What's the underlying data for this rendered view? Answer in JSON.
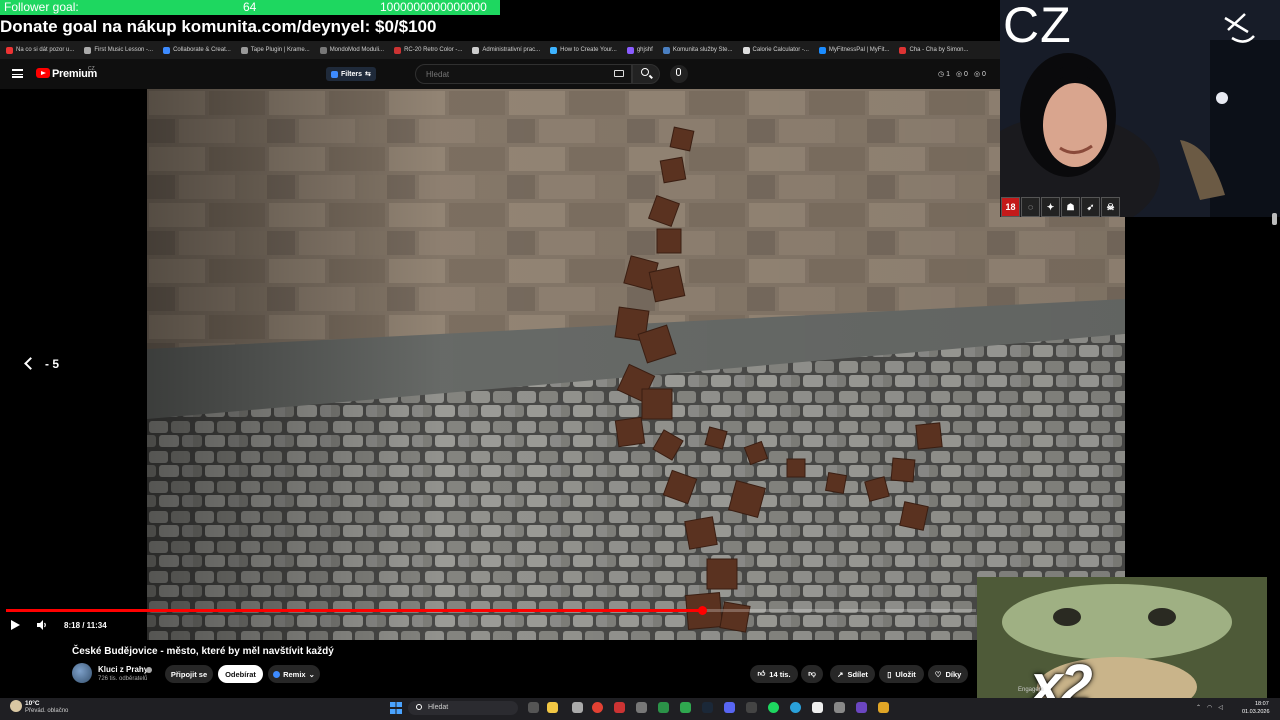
{
  "overlay": {
    "follower_label": "Follower goal:",
    "follower_count": "64",
    "follower_target": "1000000000000000",
    "donate_text": "Donate goal na nákup komunita.com/deynyel: $0/$100",
    "cz_label": "CZ",
    "badge_18": "18",
    "meme_multiplier": "x2",
    "engagement": "Engagem"
  },
  "bookmarks": [
    {
      "label": "Na co si dát pozor u...",
      "color": "#e33"
    },
    {
      "label": "First Music Lesson -...",
      "color": "#aaa"
    },
    {
      "label": "Collaborate & Creat...",
      "color": "#3d8bff"
    },
    {
      "label": "Tape Plugin | Krame...",
      "color": "#999"
    },
    {
      "label": "MondoMod Moduli...",
      "color": "#777"
    },
    {
      "label": "RC-20 Retro Color -...",
      "color": "#c33"
    },
    {
      "label": "Administrativní prac...",
      "color": "#ccc"
    },
    {
      "label": "How to Create Your...",
      "color": "#3db3ff"
    },
    {
      "label": "ghjshf",
      "color": "#8a5cff"
    },
    {
      "label": "Komunita služby Ste...",
      "color": "#4a7fc1"
    },
    {
      "label": "Calorie Calculator -...",
      "color": "#ddd"
    },
    {
      "label": "MyFitnessPal | MyFit...",
      "color": "#1b8cff"
    },
    {
      "label": "Cha - Cha by Simon...",
      "color": "#d33"
    }
  ],
  "youtube": {
    "brand": "Premium",
    "region": "CZ",
    "filters_label": "Filters",
    "search_placeholder": "Hledat",
    "stats": [
      "1",
      "0",
      "0"
    ]
  },
  "player": {
    "skip_label": "- 5",
    "current_time": "8:18",
    "duration": "11:34",
    "time_label": "8:18 / 11:34",
    "progress": 0.7176
  },
  "video": {
    "title": "České Budějovice - město, které by měl navštívit každý",
    "channel": "Kluci z Prahy",
    "subscribers": "726 tis. odběratelů",
    "join_label": "Připojit se",
    "subscribe_label": "Odebírat",
    "remix_label": "Remix",
    "likes": "14 tis.",
    "share_label": "Sdílet",
    "save_label": "Uložit",
    "thanks_label": "Díky"
  },
  "taskbar": {
    "weather_temp": "10°C",
    "weather_desc": "Převád. oblačno",
    "search_label": "Hledat",
    "time": "18:07",
    "date": "01.03.2026"
  },
  "colors": {
    "progress": "#ff0000",
    "follower_bar": "#1ed760",
    "youtube_red": "#ff0000"
  }
}
